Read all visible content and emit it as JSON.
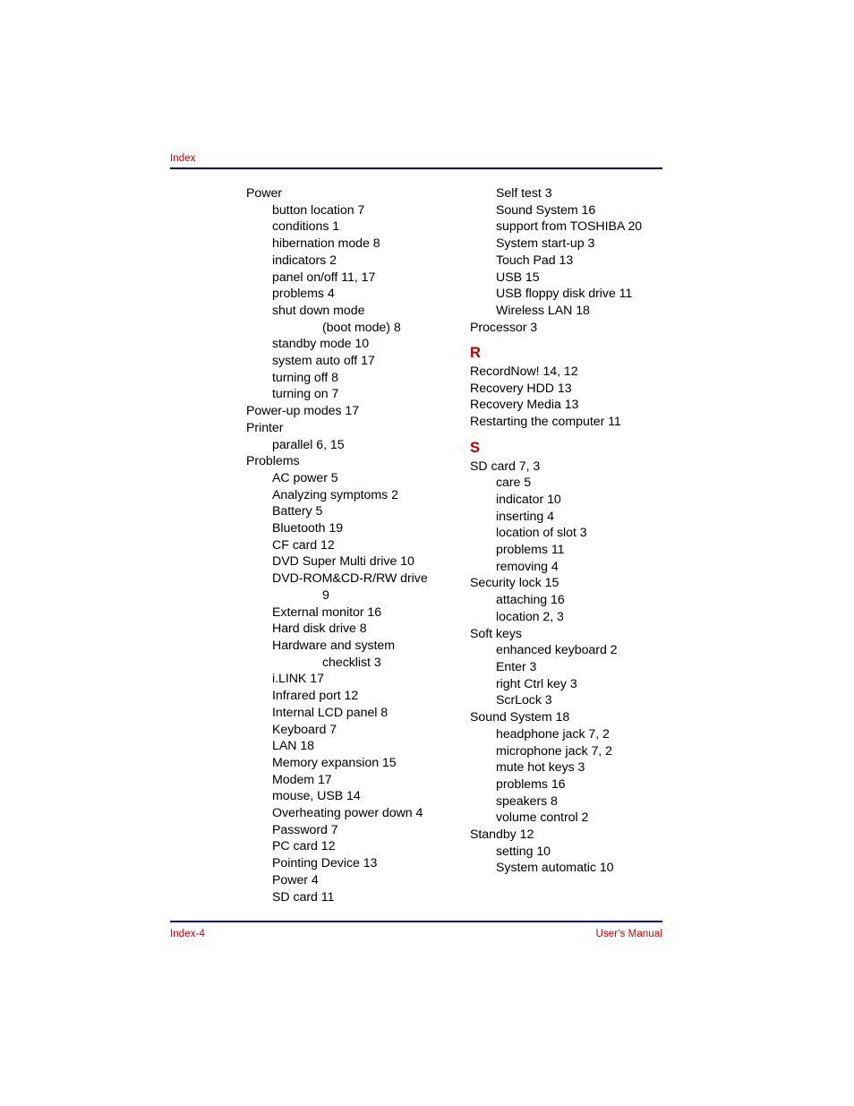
{
  "header": {
    "label": "Index",
    "rule_color": "#000080"
  },
  "footer": {
    "page_label": "Index-4",
    "manual_label": "User's Manual",
    "text_color": "#cc0000",
    "rule_color": "#000080"
  },
  "section_letter_color": "#b00000",
  "columns": [
    {
      "name": "left-column",
      "entries": [
        {
          "level": 0,
          "text": "Power"
        },
        {
          "level": 1,
          "text": "button location 7"
        },
        {
          "level": 1,
          "text": "conditions 1"
        },
        {
          "level": 1,
          "text": "hibernation mode 8"
        },
        {
          "level": 1,
          "text": "indicators 2"
        },
        {
          "level": 1,
          "text": "panel on/off 11, 17"
        },
        {
          "level": 1,
          "text": "problems 4"
        },
        {
          "level": 1,
          "text": "shut down mode"
        },
        {
          "level": 2,
          "text": "(boot mode) 8"
        },
        {
          "level": 1,
          "text": "standby mode 10"
        },
        {
          "level": 1,
          "text": "system auto off 17"
        },
        {
          "level": 1,
          "text": "turning off 8"
        },
        {
          "level": 1,
          "text": "turning on 7"
        },
        {
          "level": 0,
          "text": "Power-up modes 17"
        },
        {
          "level": 0,
          "text": "Printer"
        },
        {
          "level": 1,
          "text": "parallel 6, 15"
        },
        {
          "level": 0,
          "text": "Problems"
        },
        {
          "level": 1,
          "text": "AC power 5"
        },
        {
          "level": 1,
          "text": "Analyzing symptoms 2"
        },
        {
          "level": 1,
          "text": "Battery 5"
        },
        {
          "level": 1,
          "text": "Bluetooth 19"
        },
        {
          "level": 1,
          "text": "CF card 12"
        },
        {
          "level": 1,
          "text": "DVD Super Multi drive 10"
        },
        {
          "level": 1,
          "text": "DVD-ROM&CD-R/RW drive"
        },
        {
          "level": 2,
          "text": "9"
        },
        {
          "level": 1,
          "text": "External monitor 16"
        },
        {
          "level": 1,
          "text": "Hard disk drive 8"
        },
        {
          "level": 1,
          "text": "Hardware and system"
        },
        {
          "level": 2,
          "text": "checklist 3"
        },
        {
          "level": 1,
          "text": "i.LINK 17"
        },
        {
          "level": 1,
          "text": "Infrared port 12"
        },
        {
          "level": 1,
          "text": "Internal LCD panel 8"
        },
        {
          "level": 1,
          "text": "Keyboard 7"
        },
        {
          "level": 1,
          "text": "LAN 18"
        },
        {
          "level": 1,
          "text": "Memory expansion 15"
        },
        {
          "level": 1,
          "text": "Modem 17"
        },
        {
          "level": 1,
          "text": "mouse, USB 14"
        },
        {
          "level": 1,
          "text": "Overheating power down 4"
        },
        {
          "level": 1,
          "text": "Password 7"
        },
        {
          "level": 1,
          "text": "PC card 12"
        },
        {
          "level": 1,
          "text": "Pointing Device 13"
        },
        {
          "level": 1,
          "text": "Power 4"
        },
        {
          "level": 1,
          "text": "SD card 11"
        }
      ]
    },
    {
      "name": "right-column",
      "entries": [
        {
          "level": 1,
          "text": "Self test 3"
        },
        {
          "level": 1,
          "text": "Sound System 16"
        },
        {
          "level": 1,
          "text": "support from TOSHIBA 20"
        },
        {
          "level": 1,
          "text": "System start-up 3"
        },
        {
          "level": 1,
          "text": "Touch Pad 13"
        },
        {
          "level": 1,
          "text": "USB 15"
        },
        {
          "level": 1,
          "text": "USB floppy disk drive 11"
        },
        {
          "level": 1,
          "text": "Wireless LAN 18"
        },
        {
          "level": 0,
          "text": "Processor 3"
        },
        {
          "level": "letter",
          "text": "R"
        },
        {
          "level": 0,
          "text": "RecordNow! 14, 12"
        },
        {
          "level": 0,
          "text": "Recovery HDD 13"
        },
        {
          "level": 0,
          "text": "Recovery Media 13"
        },
        {
          "level": 0,
          "text": "Restarting the computer 11"
        },
        {
          "level": "letter",
          "text": "S"
        },
        {
          "level": 0,
          "text": "SD card 7, 3"
        },
        {
          "level": 1,
          "text": "care 5"
        },
        {
          "level": 1,
          "text": "indicator 10"
        },
        {
          "level": 1,
          "text": "inserting 4"
        },
        {
          "level": 1,
          "text": "location of slot 3"
        },
        {
          "level": 1,
          "text": "problems 11"
        },
        {
          "level": 1,
          "text": "removing 4"
        },
        {
          "level": 0,
          "text": "Security lock 15"
        },
        {
          "level": 1,
          "text": "attaching 16"
        },
        {
          "level": 1,
          "text": "location 2, 3"
        },
        {
          "level": 0,
          "text": "Soft keys"
        },
        {
          "level": 1,
          "text": "enhanced keyboard 2"
        },
        {
          "level": 1,
          "text": "Enter 3"
        },
        {
          "level": 1,
          "text": "right Ctrl key 3"
        },
        {
          "level": 1,
          "text": "ScrLock 3"
        },
        {
          "level": 0,
          "text": "Sound System 18"
        },
        {
          "level": 1,
          "text": "headphone jack 7, 2"
        },
        {
          "level": 1,
          "text": "microphone jack 7, 2"
        },
        {
          "level": 1,
          "text": "mute hot keys 3"
        },
        {
          "level": 1,
          "text": "problems 16"
        },
        {
          "level": 1,
          "text": "speakers 8"
        },
        {
          "level": 1,
          "text": "volume control 2"
        },
        {
          "level": 0,
          "text": "Standby 12"
        },
        {
          "level": 1,
          "text": "setting 10"
        },
        {
          "level": 1,
          "text": "System automatic 10"
        }
      ]
    }
  ]
}
